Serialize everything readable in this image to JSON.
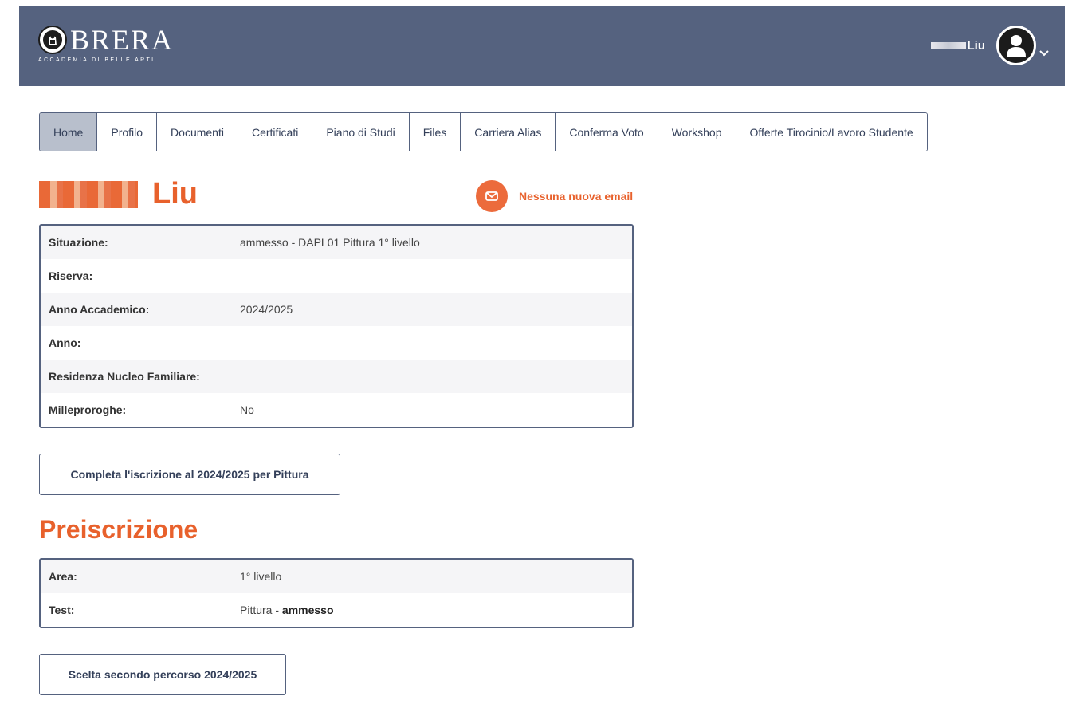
{
  "header": {
    "logo_title": "BRERA",
    "logo_subtitle": "ACCADEMIA DI BELLE ARTI",
    "user_name": "Liu",
    "colors": {
      "header_bg": "#55627f",
      "accent": "#e8612c"
    },
    "icons": {
      "logo": "brera-seal-icon",
      "avatar": "user-avatar-icon",
      "menu": "chevron-down-icon"
    }
  },
  "nav": {
    "tabs": [
      {
        "label": "Home",
        "active": true
      },
      {
        "label": "Profilo"
      },
      {
        "label": "Documenti"
      },
      {
        "label": "Certificati"
      },
      {
        "label": "Piano di Studi"
      },
      {
        "label": "Files"
      },
      {
        "label": "Carriera Alias"
      },
      {
        "label": "Conferma Voto"
      },
      {
        "label": "Workshop"
      },
      {
        "label": "Offerte Tirocinio/Lavoro Studente"
      }
    ]
  },
  "student": {
    "name": "Liu",
    "email_status": "Nessuna nuova email"
  },
  "status_table": {
    "rows": [
      {
        "label": "Situazione:",
        "value": "ammesso - DAPL01 Pittura 1° livello"
      },
      {
        "label": "Riserva:",
        "value": ""
      },
      {
        "label": "Anno Accademico:",
        "value": "2024/2025"
      },
      {
        "label": "Anno:",
        "value": ""
      },
      {
        "label": "Residenza Nucleo Familiare:",
        "value": ""
      },
      {
        "label": "Milleproroghe:",
        "value": "No"
      }
    ]
  },
  "enroll_button": {
    "label": "Completa l'iscrizione al 2024/2025 per Pittura"
  },
  "preiscrizione": {
    "title": "Preiscrizione",
    "rows": [
      {
        "label": "Area:",
        "value": "1° livello"
      },
      {
        "label": "Test:",
        "value": "Pittura - ",
        "value_bold": "ammesso"
      }
    ]
  },
  "second_path_button": {
    "label": "Scelta secondo percorso 2024/2025"
  }
}
